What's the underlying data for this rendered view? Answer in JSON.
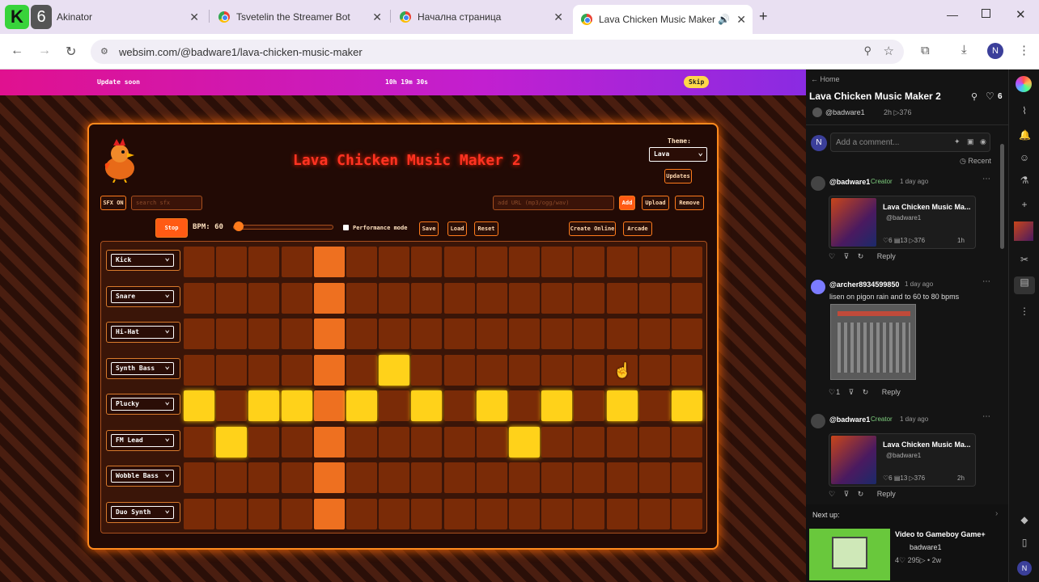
{
  "tabs": [
    {
      "title": "Akinator",
      "badge": "6"
    },
    {
      "title": "Tsvetelin the Streamer Bot"
    },
    {
      "title": "Начална страница"
    },
    {
      "title": "Lava Chicken Music Maker"
    }
  ],
  "url": "websim.com/@badware1/lava-chicken-music-maker",
  "profile_initial": "N",
  "banner": {
    "left": "Update soon",
    "center": "10h 19m 30s",
    "skip": "Skip"
  },
  "app": {
    "title": "Lava Chicken Music Maker 2",
    "theme_label": "Theme:",
    "theme_value": "Lava",
    "updates": "Updates",
    "sfx_on": "SFX ON",
    "search_placeholder": "search sfx",
    "url_placeholder": "add URL (mp3/ogg/wav)",
    "add": "Add",
    "upload": "Upload",
    "remove": "Remove",
    "stop": "Stop",
    "bpm_label": "BPM: 60",
    "bpm": 60,
    "performance": "Performance mode",
    "save": "Save",
    "load": "Load",
    "reset": "Reset",
    "create_online": "Create Online",
    "arcade": "Arcade",
    "instruments": [
      "Kick",
      "Snare",
      "Hi-Hat",
      "Synth Bass",
      "Plucky",
      "FM Lead",
      "Wobble Bass",
      "Duo Synth"
    ],
    "steps": 16,
    "playhead_step": 4,
    "pattern": [
      [],
      [],
      [],
      [
        6
      ],
      [
        0,
        2,
        3,
        5,
        7,
        9,
        11,
        13,
        15
      ],
      [
        1,
        10
      ],
      [],
      []
    ]
  },
  "sidebar": {
    "home": "Home",
    "title": "Lava Chicken Music Maker 2",
    "likes": "6",
    "author": "@badware1",
    "meta": "2h ▷376",
    "comment_placeholder": "Add a comment...",
    "sort": "Recent",
    "comments": [
      {
        "user": "@badware1",
        "badge": "Creator",
        "time": "1 day ago",
        "card_title": "Lava Chicken Music Ma...",
        "card_author": "@badware1",
        "card_stats": "♡6  ▤13  ▷376",
        "card_time": "1h",
        "reply": "Reply"
      },
      {
        "user": "@archer8934599850",
        "time": "1 day ago",
        "text": "lisen on pigon rain and to 60 to 80 bpms",
        "likes": "1",
        "reply": "Reply"
      },
      {
        "user": "@badware1",
        "badge": "Creator",
        "time": "1 day ago",
        "card_title": "Lava Chicken Music Ma...",
        "card_author": "@badware1",
        "card_stats": "♡6  ▤13  ▷376",
        "card_time": "2h",
        "reply": "Reply"
      }
    ],
    "next_up": "Next up:",
    "next": {
      "title": "Video to Gameboy Game+",
      "author": "badware1",
      "stats": "4♡ 295▷ • 2w"
    }
  },
  "colors": {
    "accent": "#ff7b1c",
    "on": "#ffd21a",
    "playhead": "#ee7020",
    "title": "#ff3322"
  }
}
